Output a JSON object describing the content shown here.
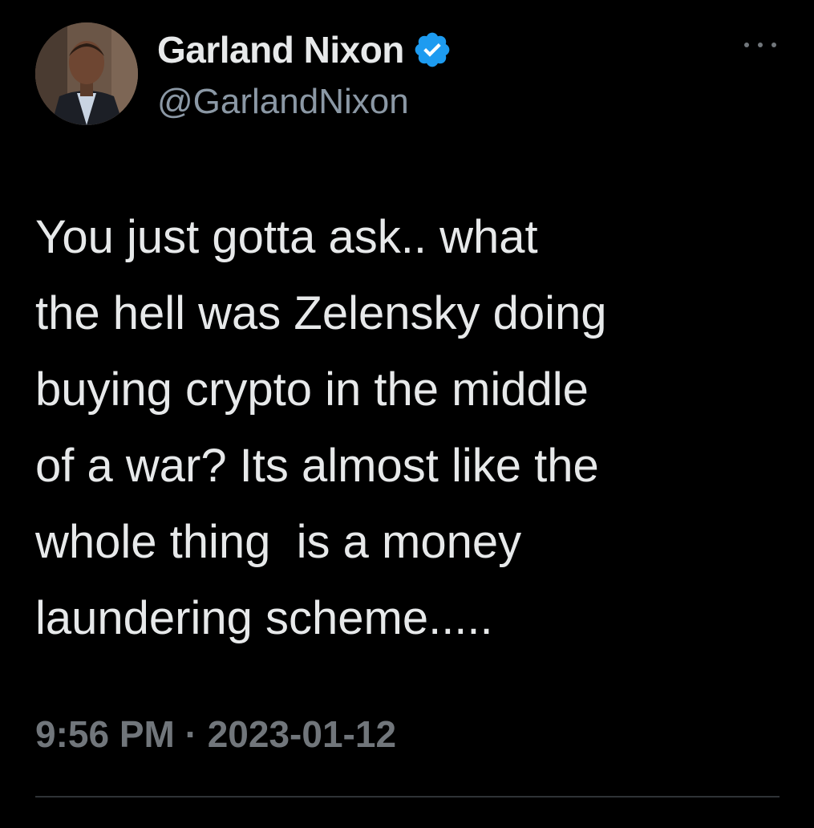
{
  "author": {
    "display_name": "Garland Nixon",
    "handle": "@GarlandNixon",
    "verified": true
  },
  "tweet": {
    "text": "You just gotta ask.. what\nthe hell was Zelensky doing\nbuying crypto in the middle\nof a war? Its almost like the\nwhole thing  is a money\nlaundering scheme.....",
    "timestamp": "9:56 PM · 2023-01-12"
  },
  "colors": {
    "background": "#000000",
    "text": "#e7e9ea",
    "secondary_text": "#71767b",
    "verified_badge": "#1d9bf0"
  },
  "icons": {
    "verified": "verified-badge-icon",
    "more": "more-options-icon"
  }
}
